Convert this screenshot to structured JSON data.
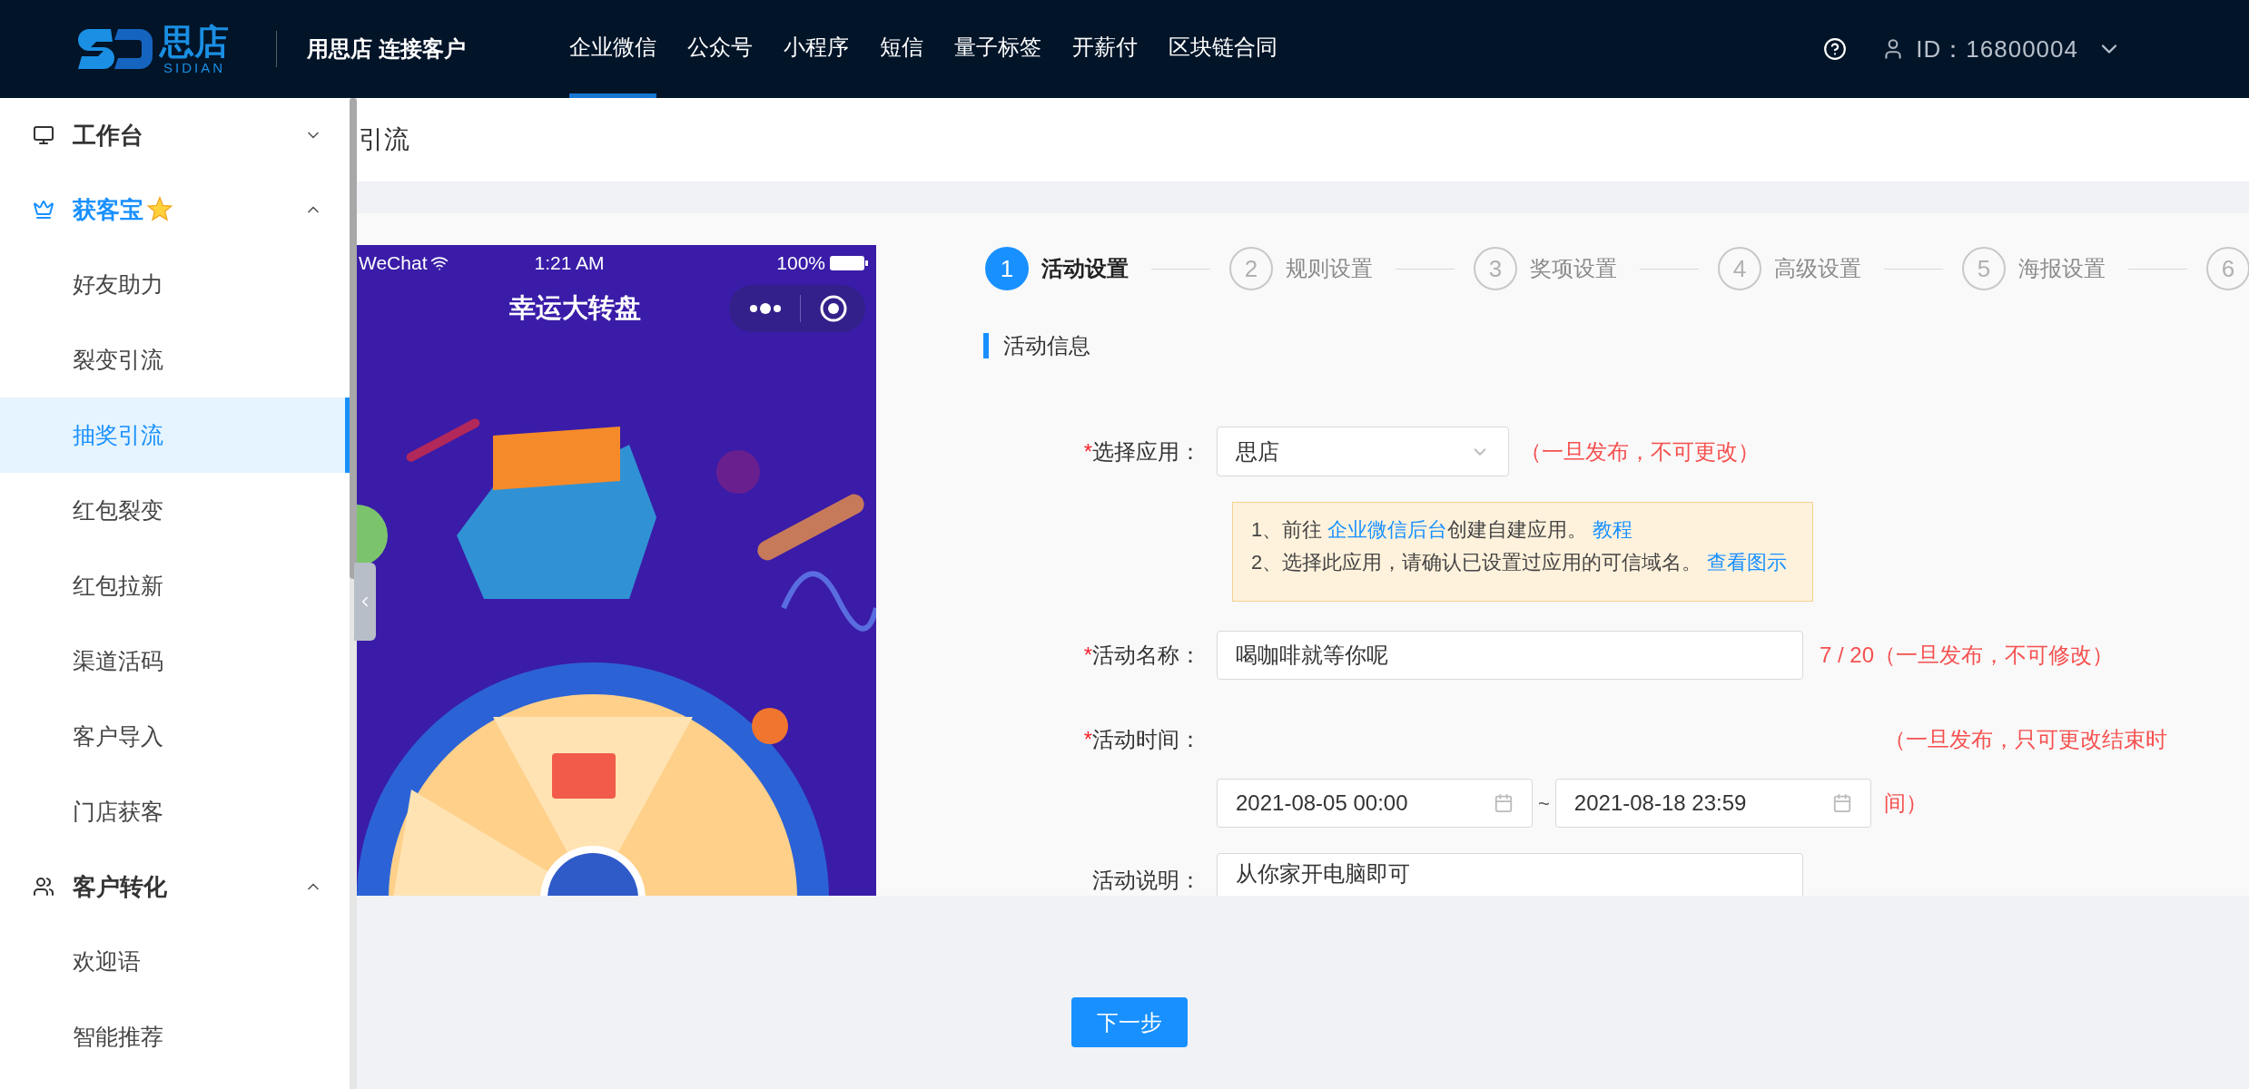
{
  "header": {
    "logo": {
      "name": "思店",
      "subtitle": "SIDIAN"
    },
    "tagline": "用思店 连接客户",
    "nav": [
      {
        "label": "企业微信",
        "selected": true
      },
      {
        "label": "公众号",
        "selected": false
      },
      {
        "label": "小程序",
        "selected": false
      },
      {
        "label": "短信",
        "selected": false
      },
      {
        "label": "量子标签",
        "selected": false
      },
      {
        "label": "开薪付",
        "selected": false
      },
      {
        "label": "区块链合同",
        "selected": false
      }
    ],
    "user_id": "ID：16800004"
  },
  "sidebar": {
    "groups": [
      {
        "label": "工作台",
        "selected": false,
        "starred": false,
        "expanded": false
      },
      {
        "label": "获客宝",
        "selected": true,
        "starred": true,
        "expanded": true,
        "children": [
          {
            "label": "好友助力",
            "selected": false
          },
          {
            "label": "裂变引流",
            "selected": false
          },
          {
            "label": "抽奖引流",
            "selected": true
          },
          {
            "label": "红包裂变",
            "selected": false
          },
          {
            "label": "红包拉新",
            "selected": false
          },
          {
            "label": "渠道活码",
            "selected": false
          },
          {
            "label": "客户导入",
            "selected": false
          },
          {
            "label": "门店获客",
            "selected": false
          }
        ]
      },
      {
        "label": "客户转化",
        "selected": false,
        "starred": false,
        "expanded": true,
        "children": [
          {
            "label": "欢迎语",
            "selected": false
          },
          {
            "label": "智能推荐",
            "selected": false
          }
        ]
      }
    ]
  },
  "breadcrumb": "引流",
  "preview": {
    "carrier": "WeChat",
    "time": "1:21 AM",
    "battery": "100%",
    "title": "幸运大转盘"
  },
  "steps": [
    {
      "number": "1",
      "label": "活动设置",
      "selected": true
    },
    {
      "number": "2",
      "label": "规则设置",
      "selected": false
    },
    {
      "number": "3",
      "label": "奖项设置",
      "selected": false
    },
    {
      "number": "4",
      "label": "高级设置",
      "selected": false
    },
    {
      "number": "5",
      "label": "海报设置",
      "selected": false
    },
    {
      "number": "6",
      "selected": false
    }
  ],
  "section_title": "活动信息",
  "form": [
    {
      "kind": "select",
      "marker": "*",
      "label": "选择应用：",
      "value": "思店",
      "note": "（一旦发布，不可更改）"
    },
    {
      "kind": "info",
      "lines": [
        [
          {
            "text": "1、前往 "
          },
          {
            "text": "企业微信后台",
            "link": true
          },
          {
            "text": "创建自建应用。 "
          },
          {
            "text": "教程",
            "link": true
          }
        ],
        [
          {
            "text": "2、选择此应用，请确认已设置过应用的可信域名。 "
          },
          {
            "text": "查看图示",
            "link": true
          }
        ]
      ]
    },
    {
      "kind": "input",
      "marker": "*",
      "label": "活动名称：",
      "value": "喝咖啡就等你呢",
      "note": "7 / 20（一旦发布，不可修改）"
    },
    {
      "kind": "daterange",
      "marker": "*",
      "label": "活动时间：",
      "start": "2021-08-05 00:00",
      "separator": "~",
      "end": "2021-08-18 23:59",
      "note": "（一旦发布，只可更改结束时间）"
    },
    {
      "kind": "textarea",
      "label": "活动说明：",
      "value": "从你家开电脑即可"
    }
  ],
  "next_button": "下一步"
}
